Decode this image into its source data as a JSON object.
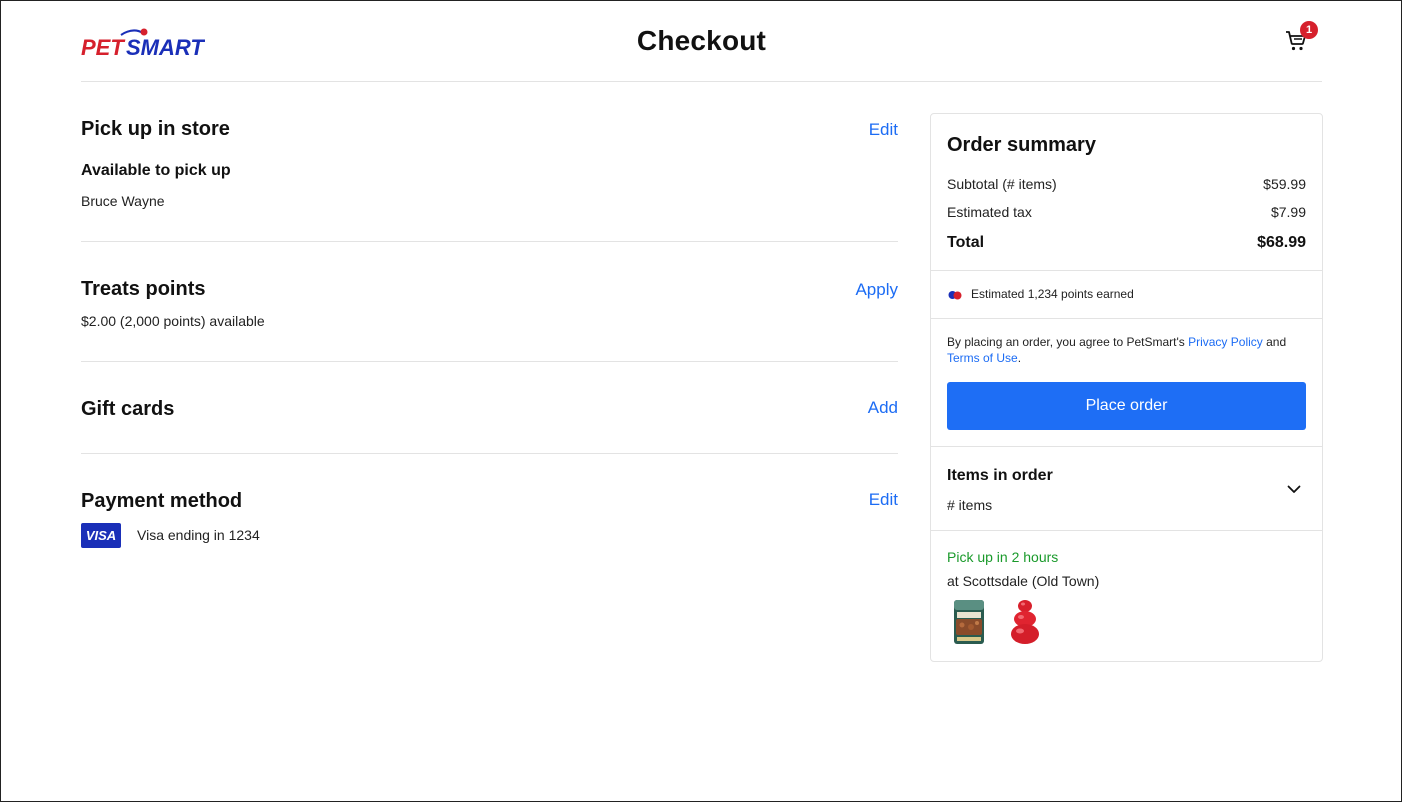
{
  "header": {
    "title": "Checkout",
    "logo_text": "PETSMART",
    "cart_count": "1"
  },
  "colors": {
    "accent": "#1e6ef5",
    "brand_red": "#d6202c",
    "brand_blue": "#1a2fb8",
    "success": "#1a9a2b"
  },
  "pickup": {
    "title": "Pick up in store",
    "edit_label": "Edit",
    "status": "Available to pick up",
    "name": "Bruce Wayne"
  },
  "treats": {
    "title": "Treats points",
    "apply_label": "Apply",
    "available": "$2.00 (2,000 points) available"
  },
  "gift": {
    "title": "Gift cards",
    "add_label": "Add"
  },
  "payment": {
    "title": "Payment method",
    "edit_label": "Edit",
    "card_brand": "VISA",
    "card_text": "Visa ending in 1234"
  },
  "summary": {
    "title": "Order summary",
    "subtotal_label": "Subtotal (# items)",
    "subtotal_value": "$59.99",
    "tax_label": "Estimated tax",
    "tax_value": "$7.99",
    "total_label": "Total",
    "total_value": "$68.99",
    "points_text": "Estimated 1,234 points earned",
    "terms_prefix": "By placing an order, you agree to PetSmart's ",
    "privacy_label": "Privacy Policy",
    "terms_mid": " and ",
    "terms_label": "Terms of Use",
    "terms_suffix": ".",
    "place_order_label": "Place order",
    "items_title": "Items in order",
    "items_count": "# items",
    "pickup_time": "Pick up in 2 hours",
    "pickup_location": "at Scottsdale (Old Town)"
  },
  "icons": [
    "cart-icon",
    "chevron-down-icon",
    "treats-points-icon"
  ]
}
